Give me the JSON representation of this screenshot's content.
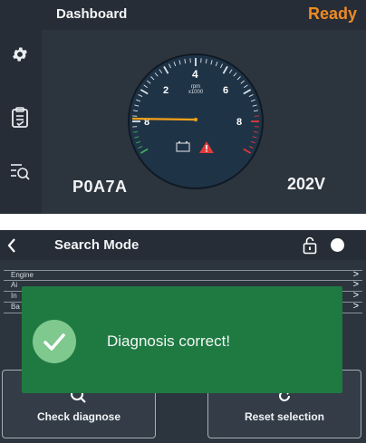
{
  "dashboard": {
    "title": "Dashboard",
    "status": "Ready",
    "fault_code": "P0A7A",
    "voltage": "202V",
    "sidebar_icons": [
      "settings-icon",
      "clipboard-checklist-icon",
      "search-list-icon"
    ],
    "gauge": {
      "tick_labels": [
        "2",
        "4",
        "6",
        "8",
        "8"
      ],
      "unit_line1": "rpm",
      "unit_line2": "x1000",
      "needle_value": 0,
      "warning_icons": [
        "battery-icon",
        "warning-triangle-icon"
      ]
    }
  },
  "search_mode": {
    "title": "Search Mode",
    "items": [
      {
        "label": "Engine",
        "chevron": ">"
      },
      {
        "label": "Ai",
        "chevron": ">"
      },
      {
        "label": "In",
        "chevron": ">"
      },
      {
        "label": "Ba",
        "chevron": ">"
      }
    ],
    "buttons": {
      "check": "Check diagnose",
      "reset": "Reset selection"
    },
    "toast": {
      "message": "Diagnosis correct!"
    }
  },
  "colors": {
    "accent": "#f08a24",
    "background": "#2c343e",
    "success": "#1f7a42",
    "alert": "#e03a3a"
  }
}
